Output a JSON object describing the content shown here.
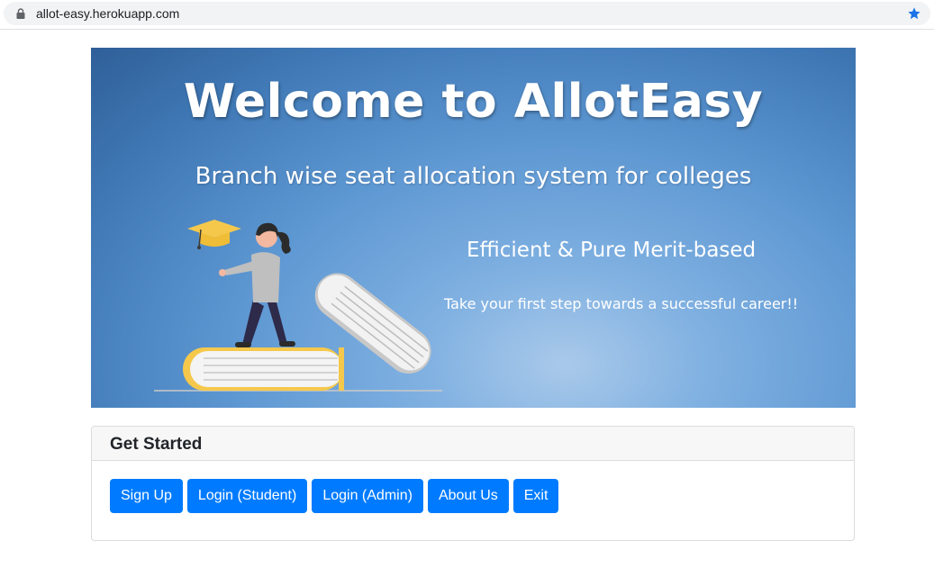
{
  "browser": {
    "url": "allot-easy.herokuapp.com",
    "lock_icon": "lock-icon",
    "star_icon": "star-icon"
  },
  "hero": {
    "title": "Welcome to AllotEasy",
    "subtitle": "Branch wise seat allocation system for colleges",
    "tagline": "Efficient & Pure Merit-based",
    "cta_text": "Take your first step towards a successful career!!"
  },
  "card": {
    "header": "Get Started",
    "buttons": [
      "Sign Up",
      "Login (Student)",
      "Login (Admin)",
      "About Us",
      "Exit"
    ]
  },
  "colors": {
    "primary": "#007bff",
    "hero_dark": "#2f5f98",
    "hero_light": "#a9c9ea",
    "star": "#1a73e8"
  }
}
